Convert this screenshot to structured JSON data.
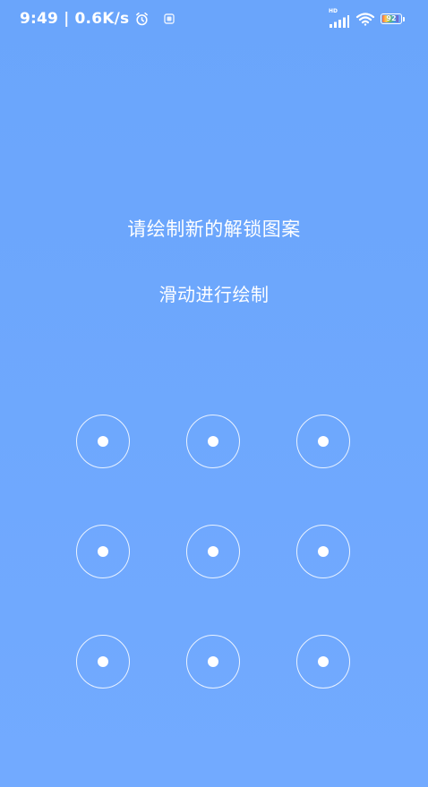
{
  "status_bar": {
    "time": "9:49",
    "separator": "|",
    "network_speed": "0.6K/s",
    "alarm_icon": "alarm-clock-icon",
    "notification_icon": "app-notification-icon",
    "network_type": "HD",
    "signal_icon": "cellular-signal-icon",
    "wifi_icon": "wifi-icon",
    "battery_level": "92",
    "battery_percent": 92
  },
  "lock_setup": {
    "title": "请绘制新的解锁图案",
    "subtitle": "滑动进行绘制"
  },
  "colors": {
    "background": "#6fa7fb",
    "foreground": "#ffffff"
  },
  "pattern": {
    "dots": [
      1,
      2,
      3,
      4,
      5,
      6,
      7,
      8,
      9
    ]
  }
}
